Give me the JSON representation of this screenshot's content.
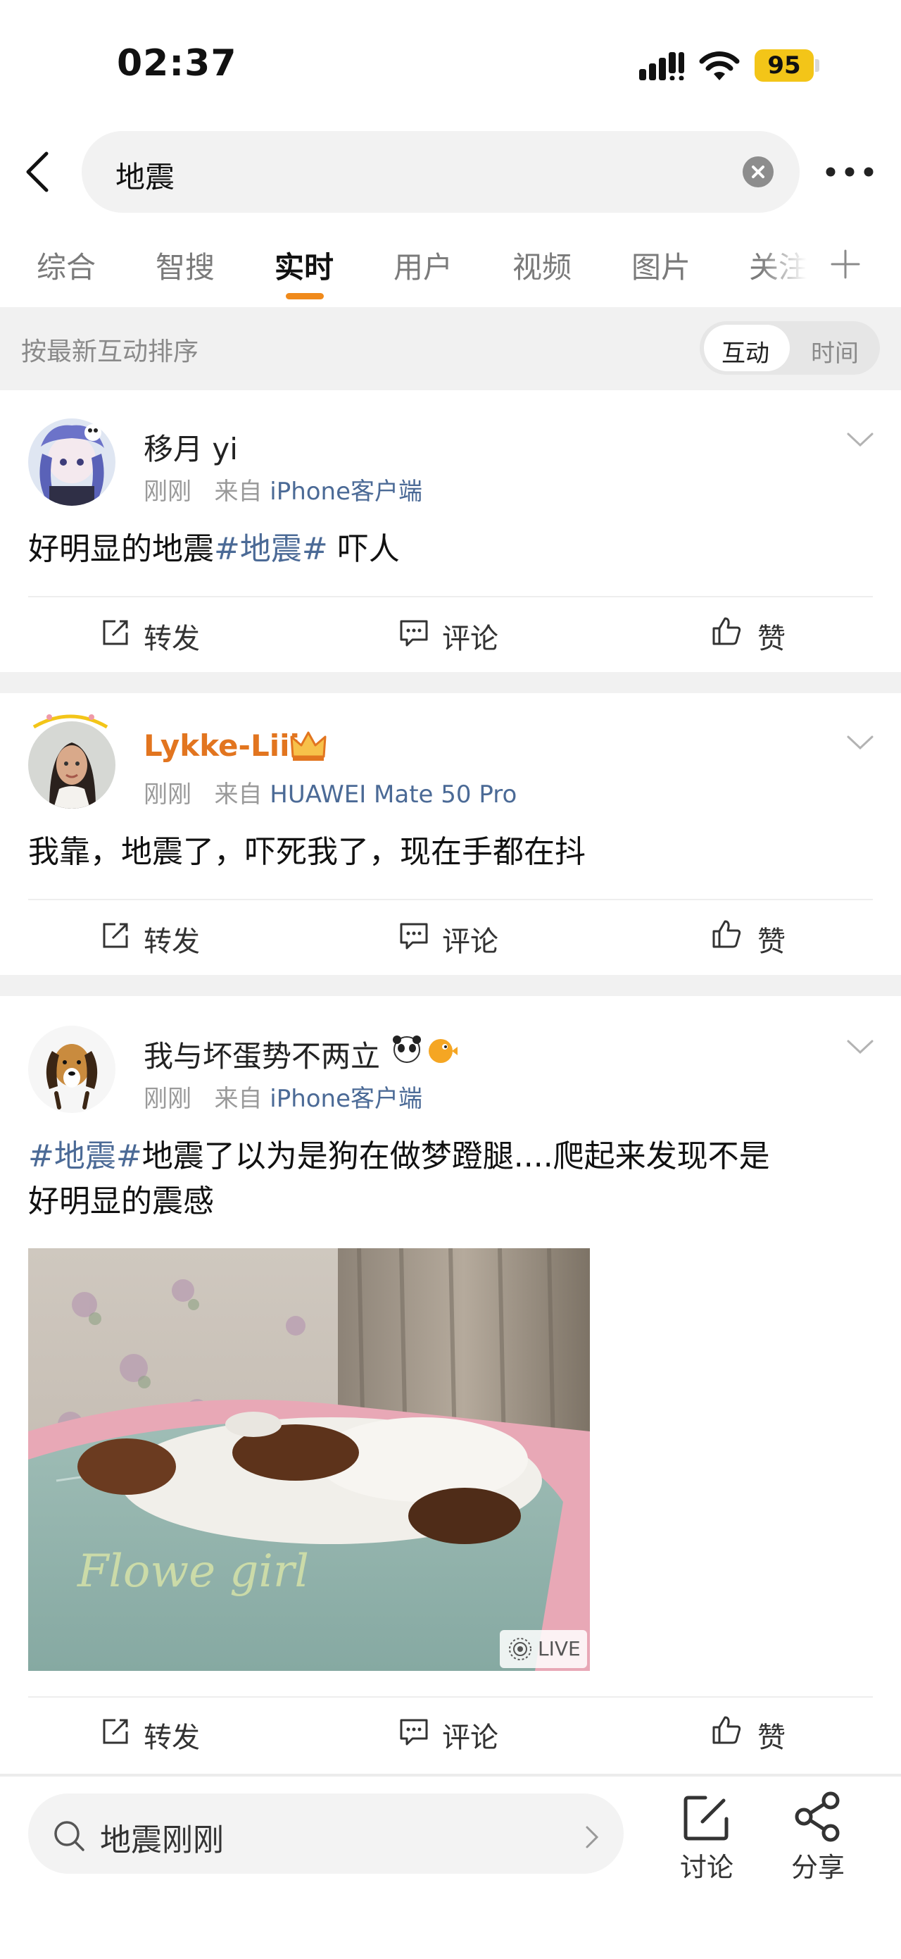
{
  "status_bar": {
    "time": "02:37",
    "battery": "95"
  },
  "search": {
    "query": "地震"
  },
  "tabs": [
    {
      "label": "综合"
    },
    {
      "label": "智搜"
    },
    {
      "label": "实时"
    },
    {
      "label": "用户"
    },
    {
      "label": "视频"
    },
    {
      "label": "图片"
    },
    {
      "label": "关注"
    }
  ],
  "sort": {
    "label": "按最新互动排序",
    "options": [
      "互动",
      "时间"
    ],
    "selected": "互动"
  },
  "posts": [
    {
      "username": "移月 yi",
      "time": "刚刚",
      "from_prefix": "来自",
      "source": "iPhone客户端",
      "content_before": "好明显的地震",
      "hashtag": "#地震#",
      "content_after": " 吓人"
    },
    {
      "username": "Lykke-Liii",
      "time": "刚刚",
      "from_prefix": "来自",
      "source": "HUAWEI Mate 50 Pro",
      "content": "我靠，地震了，吓死我了，现在手都在抖"
    },
    {
      "username": "我与坏蛋势不两立",
      "time": "刚刚",
      "from_prefix": "来自",
      "source": "iPhone客户端",
      "hashtag": "#地震#",
      "content_line1": "地震了以为是狗在做梦蹬腿....爬起来发现不是",
      "content_line2": "好明显的震感",
      "live_label": "LIVE"
    }
  ],
  "actions": {
    "repost": "转发",
    "comment": "评论",
    "like": "赞"
  },
  "bottom": {
    "search_text": "地震刚刚",
    "discuss": "讨论",
    "share": "分享"
  },
  "colors": {
    "accent": "#f08a1b",
    "link": "#4b6a96",
    "vip_name": "#e2751f",
    "battery": "#f3c518"
  }
}
